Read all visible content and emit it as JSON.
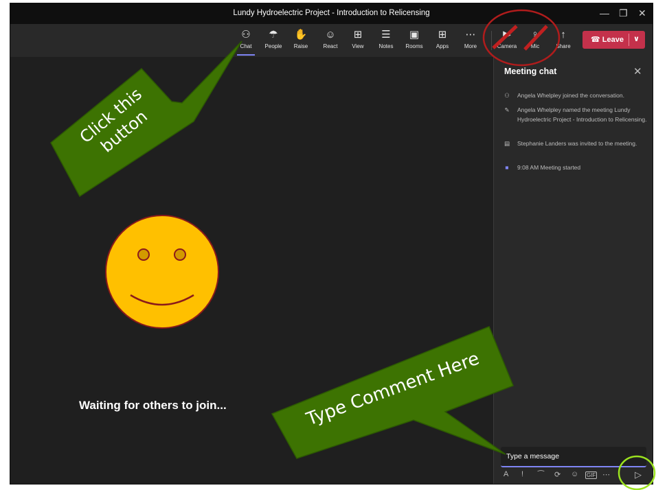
{
  "window": {
    "title": "Lundy Hydroelectric Project - Introduction to Relicensing",
    "controls": [
      "minimize-icon",
      "restore-icon",
      "close-icon"
    ]
  },
  "toolbar": {
    "buttons": [
      {
        "label": "Chat",
        "icon": "chat-icon",
        "glyph": "⚇"
      },
      {
        "label": "People",
        "icon": "people-icon",
        "glyph": "☂"
      },
      {
        "label": "Raise",
        "icon": "hand-icon",
        "glyph": "✋"
      },
      {
        "label": "React",
        "icon": "smiley-icon",
        "glyph": "☺"
      },
      {
        "label": "View",
        "icon": "view-icon",
        "glyph": "⊞"
      },
      {
        "label": "Notes",
        "icon": "notes-icon",
        "glyph": "☰"
      },
      {
        "label": "Rooms",
        "icon": "rooms-icon",
        "glyph": "▣"
      },
      {
        "label": "Apps",
        "icon": "apps-icon",
        "glyph": "⊞"
      },
      {
        "label": "More",
        "icon": "more-icon",
        "glyph": "⋯"
      },
      {
        "label": "Camera",
        "icon": "camera-off-icon",
        "glyph": "▶"
      },
      {
        "label": "Mic",
        "icon": "mic-off-icon",
        "glyph": "♀"
      },
      {
        "label": "Share",
        "icon": "share-icon",
        "glyph": "↑"
      }
    ],
    "leave_label": "Leave",
    "leave_color": "#c4314b"
  },
  "stage": {
    "waiting_text": "Waiting for others to join..."
  },
  "chat": {
    "title": "Meeting chat",
    "messages": [
      {
        "icon": "person-join-icon",
        "glyph": "⚇",
        "text": "Angela Whelpley joined the conversation."
      },
      {
        "icon": "pencil-icon",
        "glyph": "✎",
        "text": "Angela Whelpley named the meeting Lundy Hydroelectric Project - Introduction to Relicensing."
      },
      {
        "icon": "calendar-invite-icon",
        "glyph": "▤",
        "text": "Stephanie Landers was invited to the meeting."
      },
      {
        "icon": "video-icon",
        "glyph": "■",
        "text": "9:08 AM   Meeting started"
      }
    ],
    "composer_placeholder": "Type a message",
    "composer_icons": [
      {
        "name": "format-icon",
        "glyph": "A"
      },
      {
        "name": "priority-icon",
        "glyph": "!"
      },
      {
        "name": "attach-icon",
        "glyph": "⁀"
      },
      {
        "name": "loop-icon",
        "glyph": "⟳"
      },
      {
        "name": "emoji-icon",
        "glyph": "☺"
      },
      {
        "name": "gif-icon",
        "glyph": "GIF"
      },
      {
        "name": "more-options-icon",
        "glyph": "⋯"
      }
    ],
    "send_glyph": "▷"
  },
  "annotations": {
    "callout1_line1": "Click this",
    "callout1_line2": "button",
    "callout2": "Type Comment Here",
    "callout_color": "#3d7302",
    "highlight_red": "#b01c1c",
    "highlight_green": "#9be21f",
    "smiley_fill": "#ffc000"
  }
}
